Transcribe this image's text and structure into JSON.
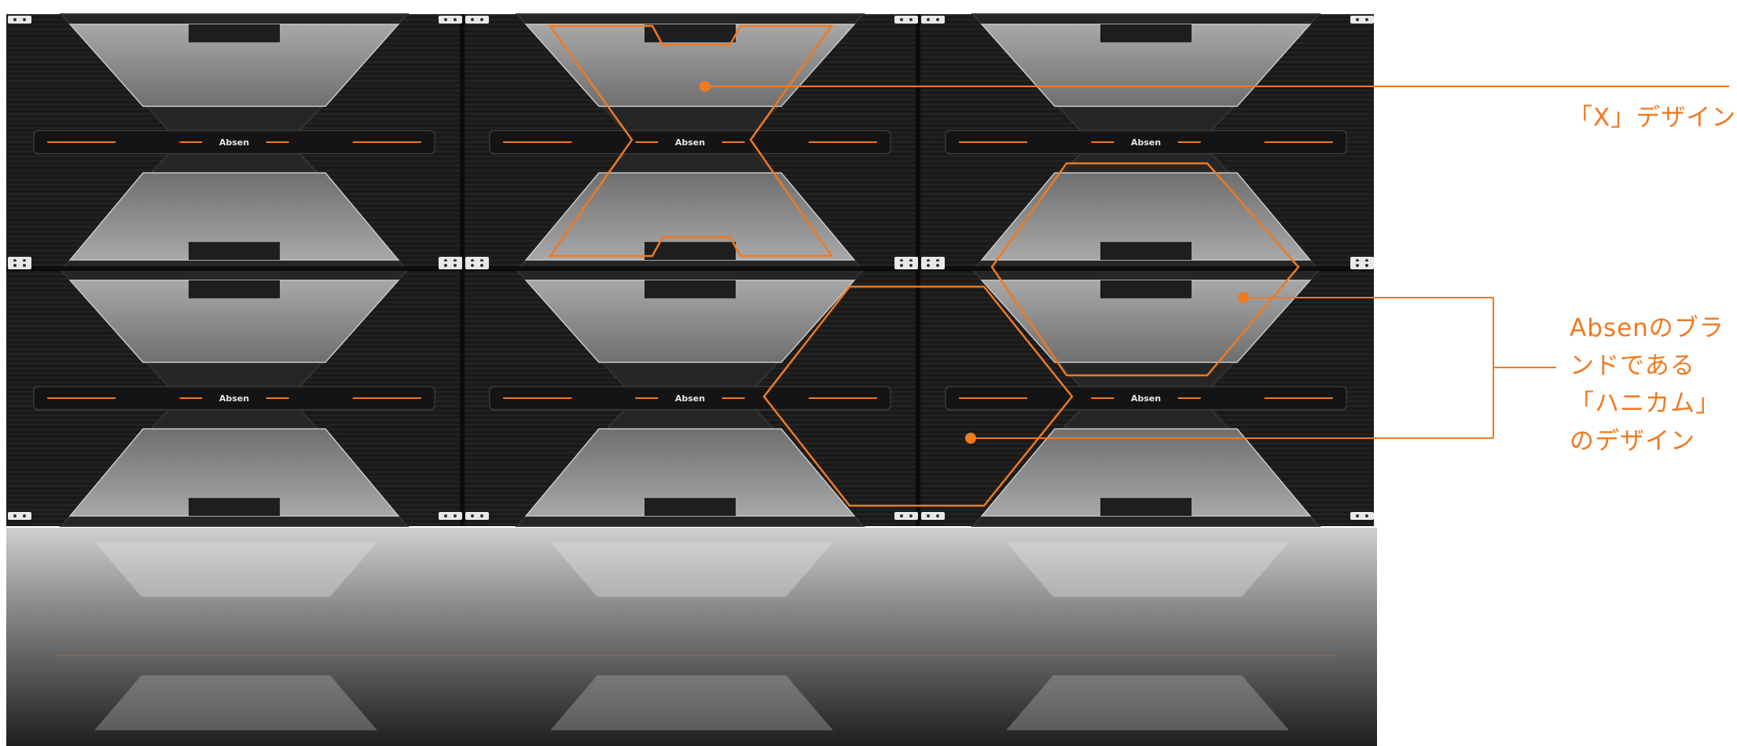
{
  "product": {
    "brand_logo_text": "Absen",
    "grid": {
      "columns": 3,
      "rows": 2
    }
  },
  "callouts": {
    "x_design": {
      "label": "「X」デザイン"
    },
    "honeycomb_design": {
      "lines": [
        "Absenのブラ",
        "ンドである",
        "「ハニカム」",
        "のデザイン"
      ]
    }
  },
  "colors": {
    "accent": "#ee7a22",
    "panel_dark": "#1b1b1b",
    "panel_frame": "#2a2a2a",
    "glass": "#8f8f8f",
    "background": "#ffffff"
  }
}
